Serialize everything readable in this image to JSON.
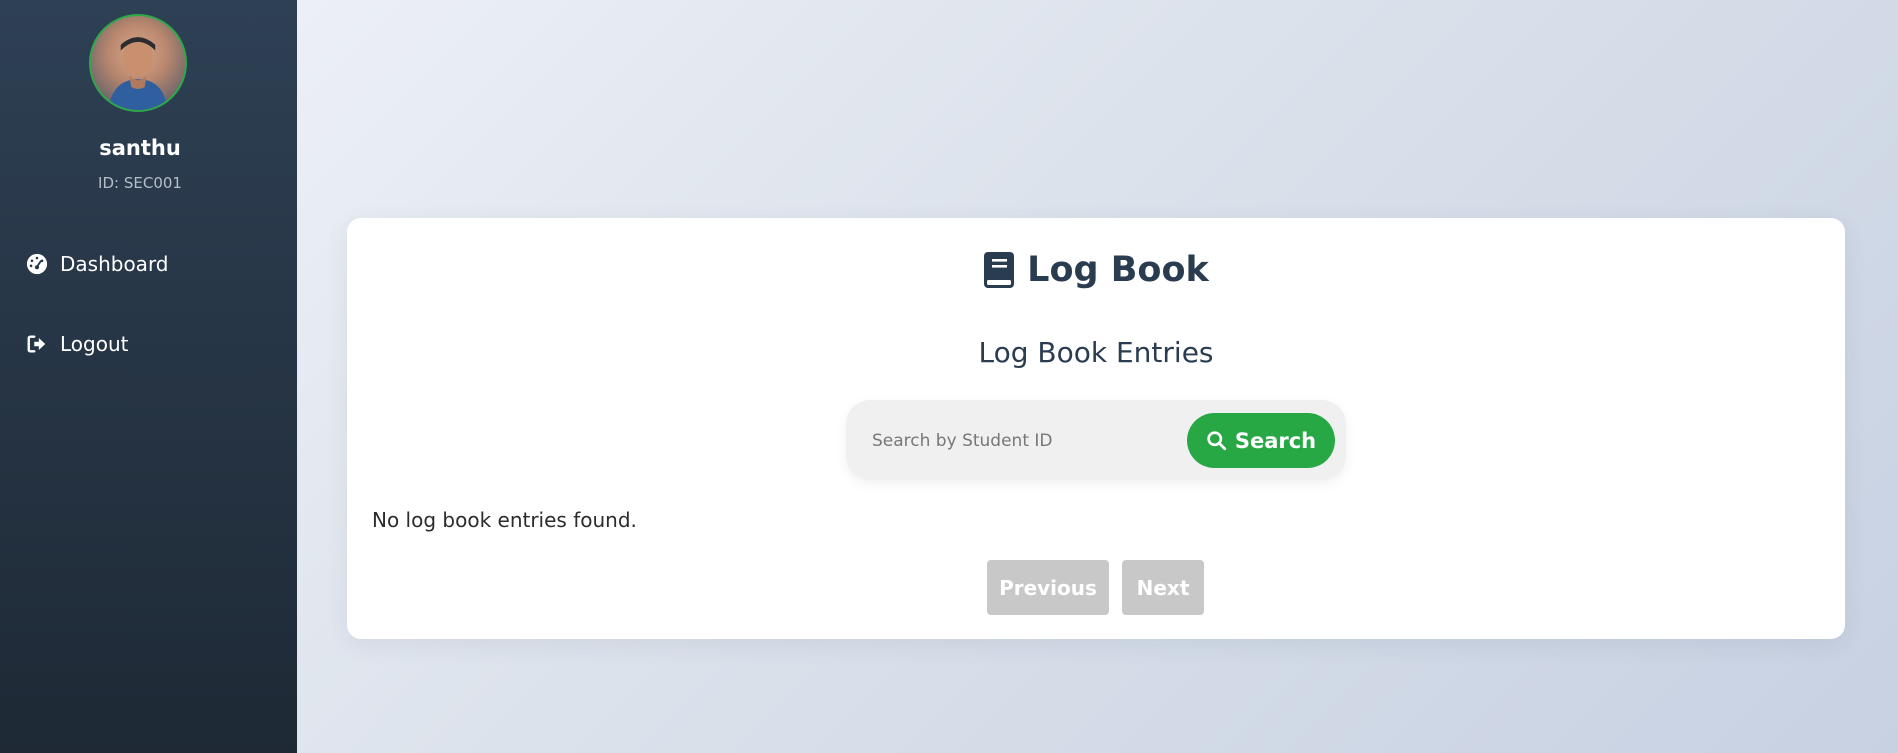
{
  "sidebar": {
    "user": {
      "name": "santhu",
      "id_label": "ID: SEC001"
    },
    "nav": [
      {
        "label": "Dashboard",
        "icon": "dashboard-gauge-icon"
      },
      {
        "label": "Logout",
        "icon": "logout-icon"
      }
    ]
  },
  "main": {
    "title": "Log Book",
    "title_icon": "book-icon",
    "subtitle": "Log Book Entries",
    "search": {
      "placeholder": "Search by Student ID",
      "value": "",
      "button_label": "Search"
    },
    "empty_message": "No log book entries found.",
    "pagination": {
      "previous_label": "Previous",
      "next_label": "Next"
    }
  },
  "colors": {
    "sidebar_top": "#2e4054",
    "sidebar_bottom": "#1e2935",
    "accent_green": "#28a745",
    "title_text": "#2a3d50",
    "disabled_button": "#c8c8c8"
  }
}
